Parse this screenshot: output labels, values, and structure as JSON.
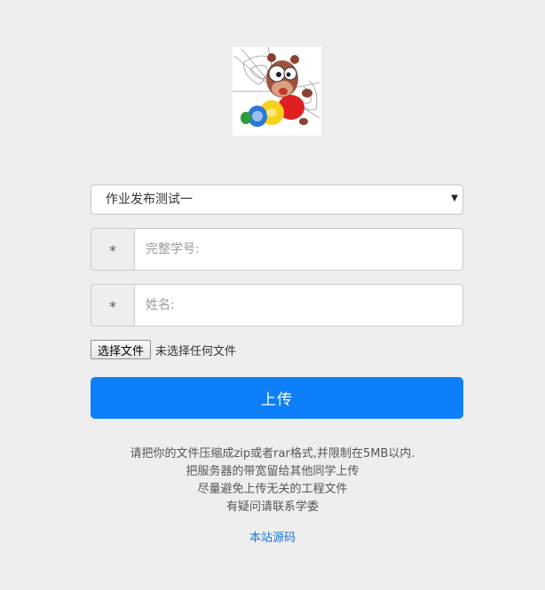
{
  "logo": {
    "icon": "bug-on-spiderweb-mascot-icon"
  },
  "assignment_select": {
    "selected": "作业发布测试一",
    "options": [
      "作业发布测试一"
    ]
  },
  "student_id": {
    "addon": "*",
    "placeholder": "完整学号:",
    "value": ""
  },
  "name": {
    "addon": "*",
    "placeholder": "姓名:",
    "value": ""
  },
  "file_input": {
    "button_label": "选择文件",
    "status": "未选择任何文件"
  },
  "upload_button": {
    "label": "上传",
    "color": "#0d7ff9"
  },
  "notes": [
    "请把你的文件压缩成zip或者rar格式,并限制在5MB以内.",
    "把服务器的带宽留给其他同学上传",
    "尽量避免上传无关的工程文件",
    "有疑问请联系学委"
  ],
  "source_link": {
    "label": "本站源码",
    "color": "#1a73d9"
  }
}
